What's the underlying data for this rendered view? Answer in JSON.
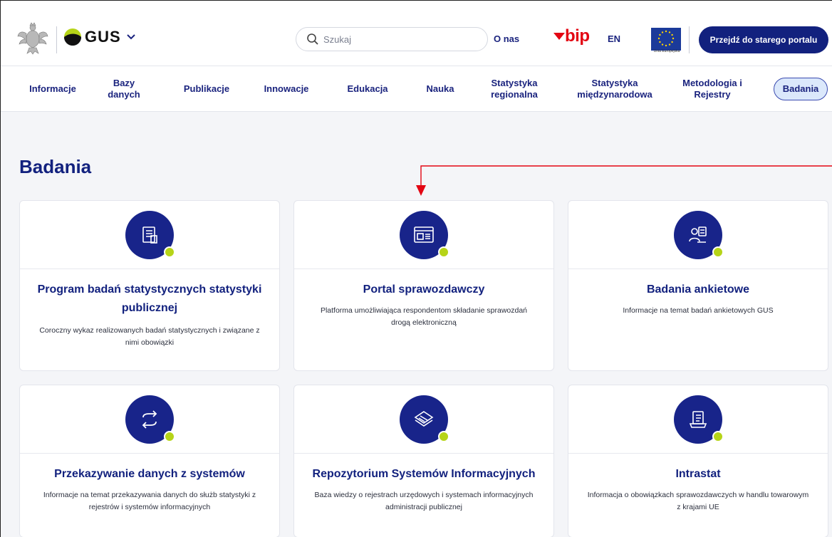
{
  "header": {
    "logo_text": "GUS",
    "search_placeholder": "Szukaj",
    "about_label": "O nas",
    "bip_label": "bip",
    "language_label": "EN",
    "eu_caption": "Unia Europejska",
    "old_portal_label": "Przejdź do starego portalu"
  },
  "nav": {
    "items": [
      {
        "label": "Informacje"
      },
      {
        "label": "Bazy danych"
      },
      {
        "label": "Publikacje"
      },
      {
        "label": "Innowacje"
      },
      {
        "label": "Edukacja"
      },
      {
        "label": "Nauka"
      },
      {
        "label": "Statystyka regionalna"
      },
      {
        "label": "Statystyka międzynarodowa"
      },
      {
        "label": "Metodologia i Rejestry"
      },
      {
        "label": "Badania"
      }
    ],
    "active_index": 9
  },
  "page": {
    "title": "Badania"
  },
  "cards": [
    {
      "icon": "document-list-icon",
      "title": "Program badań statystycznych statystyki publicznej",
      "description": "Coroczny wykaz realizowanych badań statystycznych i związane z nimi obowiązki"
    },
    {
      "icon": "browser-window-icon",
      "title": "Portal sprawozdawczy",
      "description": "Platforma umożliwiająca respondentom składanie sprawozdań drogą elektroniczną"
    },
    {
      "icon": "survey-people-icon",
      "title": "Badania ankietowe",
      "description": "Informacje na temat badań ankietowych GUS"
    },
    {
      "icon": "exchange-arrows-icon",
      "title": "Przekazywanie danych z systemów",
      "description": "Informacje na temat przekazywania danych do służb statystyki z rejestrów i systemów informacyjnych"
    },
    {
      "icon": "repository-stack-icon",
      "title": "Repozytorium Systemów Informacyjnych",
      "description": "Baza wiedzy o rejestrach urzędowych i systemach informacyjnych administracji publicznej"
    },
    {
      "icon": "laptop-checklist-icon",
      "title": "Intrastat",
      "description": "Informacja o obowiązkach sprawozdawczych w handlu towarowym z krajami UE"
    }
  ],
  "colors": {
    "brand_navy": "#12217e",
    "accent_lime": "#b6d418",
    "annotation_red": "#e30613",
    "active_tab_bg": "#dbe8fb"
  }
}
